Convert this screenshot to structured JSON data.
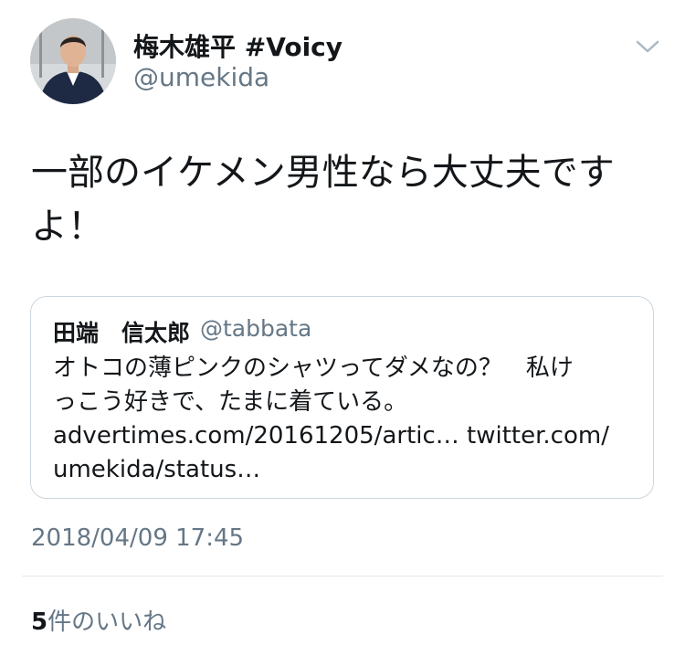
{
  "author": {
    "display_name": "梅木雄平 #Voicy",
    "handle": "@umekida",
    "avatar_icon": "profile-photo"
  },
  "tweet": {
    "text_line1": "一部のイケメン男性なら大丈夫です",
    "text_line2": "よ！"
  },
  "quoted_tweet": {
    "display_name": "田端　信太郎",
    "handle": "@tabbata",
    "text_line1": "オトコの薄ピンクのシャツってダメなの？　私け",
    "text_line2": "っこう好きで、たまに着ている。",
    "text_line3": "advertimes.com/20161205/artic… twitter.com/",
    "text_line4": "umekida/status…"
  },
  "meta": {
    "timestamp": "2018/04/09 17:45",
    "likes_count": "5",
    "likes_label": "件のいいね"
  },
  "colors": {
    "text": "#14171a",
    "secondary": "#657786",
    "border": "#ccd6dd"
  }
}
